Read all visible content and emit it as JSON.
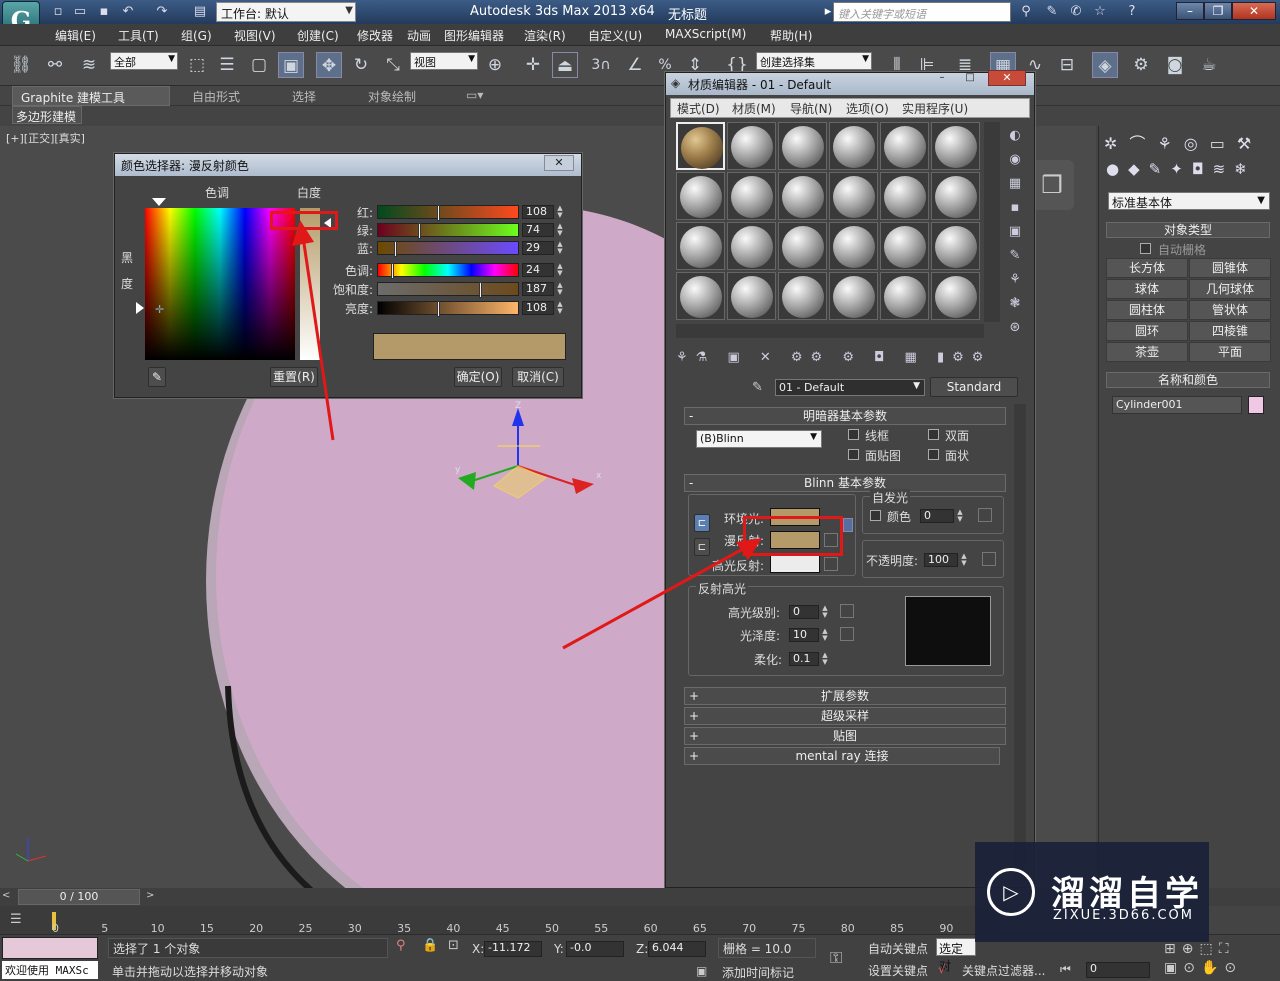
{
  "app": {
    "title": "Autodesk 3ds Max  2013 x64",
    "doc": "无标题",
    "logo": "G",
    "workspace": "工作台: 默认",
    "search_placeholder": "键入关键字或短语"
  },
  "menus": [
    "编辑(E)",
    "工具(T)",
    "组(G)",
    "视图(V)",
    "创建(C)",
    "修改器",
    "动画",
    "图形编辑器",
    "渲染(R)",
    "自定义(U)",
    "MAXScript(M)",
    "帮助(H)"
  ],
  "toolbar": {
    "select_filter": "全部",
    "ref_coord": "视图",
    "named_selection": "创建选择集",
    "snap_label": "3",
    "percent": "%"
  },
  "ribbon": {
    "tabs": [
      "Graphite 建模工具",
      "自由形式",
      "选择",
      "对象绘制"
    ],
    "sub": "多边形建模"
  },
  "viewport": {
    "label": "[+][正交][真实]",
    "axis_z": "Z",
    "axis_x": "x",
    "axis_y": "y",
    "object_color": "#cfa9c8"
  },
  "command_panel": {
    "dropdown": "标准基本体",
    "object_type_title": "对象类型",
    "autogrid": "自动栅格",
    "buttons": [
      "长方体",
      "圆锥体",
      "球体",
      "几何球体",
      "圆柱体",
      "管状体",
      "圆环",
      "四棱锥",
      "茶壶",
      "平面"
    ],
    "name_color_title": "名称和颜色",
    "object_name": "Cylinder001",
    "object_color": "#f0c8e6"
  },
  "color_picker": {
    "title": "颜色选择器: 漫反射颜色",
    "hue_label": "色调",
    "white_label": "白度",
    "black_label_1": "黑",
    "black_label_2": "度",
    "channels": [
      {
        "label": "红:",
        "value": "108"
      },
      {
        "label": "绿:",
        "value": "74"
      },
      {
        "label": "蓝:",
        "value": "29"
      },
      {
        "label": "色调:",
        "value": "24"
      },
      {
        "label": "饱和度:",
        "value": "187"
      },
      {
        "label": "亮度:",
        "value": "108"
      }
    ],
    "levels": {
      "red": 0.424,
      "green": 0.29,
      "blue": 0.114,
      "hue": 0.094,
      "saturation": 0.733,
      "value": 0.424
    },
    "reset": "重置(R)",
    "ok": "确定(O)",
    "cancel": "取消(C)",
    "preview_color": "#b49a68"
  },
  "material_editor": {
    "title": "材质编辑器 - 01 - Default",
    "menus": [
      "模式(D)",
      "材质(M)",
      "导航(N)",
      "选项(O)",
      "实用程序(U)"
    ],
    "mat_name": "01 - Default",
    "mat_type": "Standard",
    "shader_rollout": "明暗器基本参数",
    "shader": "(B)Blinn",
    "wire": "线框",
    "two_sided": "双面",
    "face_map": "面贴图",
    "faceted": "面状",
    "blinn_rollout": "Blinn 基本参数",
    "self_illum": "自发光",
    "color_chk": "颜色",
    "self_illum_value": "0",
    "ambient": "环境光:",
    "diffuse": "漫反射:",
    "specular": "高光反射:",
    "opacity_label": "不透明度:",
    "opacity_value": "100",
    "spec_highlights": "反射高光",
    "spec_level_label": "高光级别:",
    "spec_level": "0",
    "gloss_label": "光泽度:",
    "gloss": "10",
    "soften_label": "柔化:",
    "soften": "0.1",
    "rollups": [
      "扩展参数",
      "超级采样",
      "贴图",
      "mental ray 连接"
    ],
    "ambient_color": "#b49a68",
    "diffuse_color": "#b49a68",
    "specular_color": "#ececec"
  },
  "timeline": {
    "frame": "0 / 100",
    "ticks": [
      "0",
      "5",
      "10",
      "15",
      "20",
      "25",
      "30",
      "35",
      "40",
      "45",
      "50",
      "55",
      "60",
      "65",
      "70",
      "75",
      "80",
      "85",
      "90"
    ]
  },
  "status": {
    "welcome": "欢迎使用 MAXSc",
    "selected": "选择了 1 个对象",
    "prompt": "单击并拖动以选择并移动对象",
    "x_label": "X:",
    "x": "-11.172",
    "y_label": "Y:",
    "y": "-0.0",
    "z_label": "Z:",
    "z": "6.044",
    "grid": "栅格 = 10.0",
    "add_time_tag": "添加时间标记",
    "auto_key": "自动关键点",
    "set_key": "设置关键点",
    "selected_dropdown": "选定对",
    "key_filters": "关键点过滤器...",
    "frame_field": "0"
  },
  "watermark": {
    "brand": "溜溜自学",
    "url": "ZIXUE.3D66.COM"
  }
}
